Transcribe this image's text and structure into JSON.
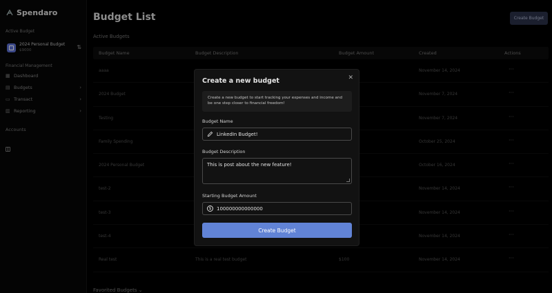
{
  "app": {
    "name": "Spendaro"
  },
  "sidebar": {
    "active_budget_label": "Active Budget",
    "active_budget": {
      "name": "2024 Personal Budget",
      "amount": "$9000"
    },
    "financial_label": "Financial Management",
    "items": [
      {
        "label": "Dashboard",
        "icon": "grid-icon"
      },
      {
        "label": "Budgets",
        "icon": "wallet-icon"
      },
      {
        "label": "Transact",
        "icon": "card-icon"
      },
      {
        "label": "Reporting",
        "icon": "chart-icon"
      }
    ],
    "accounts_label": "Accounts"
  },
  "main": {
    "title": "Budget List",
    "create_button": "Create Budget",
    "active_section": "Active Budgets",
    "favorited_section": "Favorited Budgets",
    "columns": [
      "Budget Name",
      "Budget Description",
      "Budget Amount",
      "Created",
      "Actions"
    ],
    "rows": [
      {
        "name": "aaaa",
        "desc": "",
        "amount": "",
        "created": "November 14, 2024"
      },
      {
        "name": "2024 Budget",
        "desc": "",
        "amount": "",
        "created": "November 7, 2024"
      },
      {
        "name": "Testing",
        "desc": "",
        "amount": "",
        "created": "November 7, 2024"
      },
      {
        "name": "Family Spending",
        "desc": "",
        "amount": "",
        "created": "October 25, 2024"
      },
      {
        "name": "2024 Personal Budget",
        "desc": "",
        "amount": "",
        "created": "October 16, 2024"
      },
      {
        "name": "test-2",
        "desc": "",
        "amount": "",
        "created": "November 14, 2024"
      },
      {
        "name": "test-3",
        "desc": "",
        "amount": "",
        "created": "November 14, 2024"
      },
      {
        "name": "test-4",
        "desc": "",
        "amount": "",
        "created": "November 14, 2024"
      },
      {
        "name": "Real test",
        "desc": "This is a real test budget",
        "amount": "$100",
        "created": "November 14, 2024"
      }
    ]
  },
  "modal": {
    "title": "Create a new budget",
    "info": "Create a new budget to start tracking your expenses and income and be one step closer to financial freedom!",
    "name_label": "Budget Name",
    "name_value": "LinkedIn Budget!",
    "desc_label": "Budget Description",
    "desc_value": "This is post about the new feature!",
    "amount_label": "Starting Budget Amount",
    "amount_value": "100000000000000",
    "submit": "Create Budget"
  }
}
